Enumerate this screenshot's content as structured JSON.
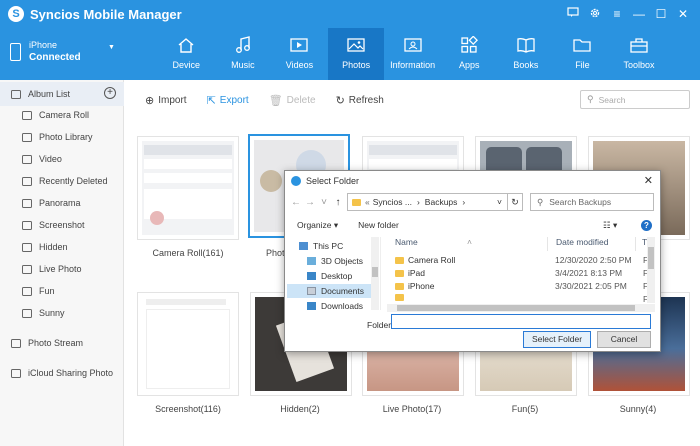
{
  "app": {
    "title": "Syncios Mobile Manager"
  },
  "device": {
    "name": "iPhone",
    "status": "Connected"
  },
  "nav_tabs": [
    {
      "label": "Device",
      "icon": "home-icon"
    },
    {
      "label": "Music",
      "icon": "music-icon"
    },
    {
      "label": "Videos",
      "icon": "video-icon"
    },
    {
      "label": "Photos",
      "icon": "photo-icon",
      "active": true
    },
    {
      "label": "Information",
      "icon": "contact-card-icon"
    },
    {
      "label": "Apps",
      "icon": "apps-icon"
    },
    {
      "label": "Books",
      "icon": "book-icon"
    },
    {
      "label": "File",
      "icon": "folder-icon"
    },
    {
      "label": "Toolbox",
      "icon": "toolbox-icon"
    }
  ],
  "sidebar": {
    "album_list": "Album List",
    "items": [
      "Camera Roll",
      "Photo Library",
      "Video",
      "Recently Deleted",
      "Panorama",
      "Screenshot",
      "Hidden",
      "Live Photo",
      "Fun",
      "Sunny"
    ],
    "photo_stream": "Photo Stream",
    "icloud": "iCloud Sharing Photo"
  },
  "toolbar": {
    "import": "Import",
    "export": "Export",
    "delete": "Delete",
    "refresh": "Refresh",
    "search_placeholder": "Search"
  },
  "albums": [
    {
      "caption": "Camera Roll(161)"
    },
    {
      "caption": "Photo"
    },
    {
      "caption": ""
    },
    {
      "caption": ""
    },
    {
      "caption": ""
    },
    {
      "caption": "Screenshot(116)"
    },
    {
      "caption": "Hidden(2)"
    },
    {
      "caption": "Live Photo(17)"
    },
    {
      "caption": "Fun(5)"
    },
    {
      "caption": "Sunny(4)"
    }
  ],
  "dialog": {
    "title": "Select Folder",
    "path": [
      "Syncios ...",
      "Backups"
    ],
    "search_placeholder": "Search Backups",
    "organize": "Organize",
    "new_folder": "New folder",
    "tree": [
      "This PC",
      "3D Objects",
      "Desktop",
      "Documents",
      "Downloads"
    ],
    "columns": {
      "name": "Name",
      "date": "Date modified",
      "type": "Ty"
    },
    "files": [
      {
        "name": "Camera Roll",
        "date": "12/30/2020 2:50 PM",
        "type": "Fi"
      },
      {
        "name": "iPad",
        "date": "3/4/2021 8:13 PM",
        "type": "Fi"
      },
      {
        "name": "iPhone",
        "date": "3/30/2021 2:05 PM",
        "type": "Fi"
      },
      {
        "name": "",
        "date": "",
        "type": "Fi"
      }
    ],
    "folder_label": "Folder:",
    "folder_value": "",
    "select_button": "Select Folder",
    "cancel_button": "Cancel"
  }
}
